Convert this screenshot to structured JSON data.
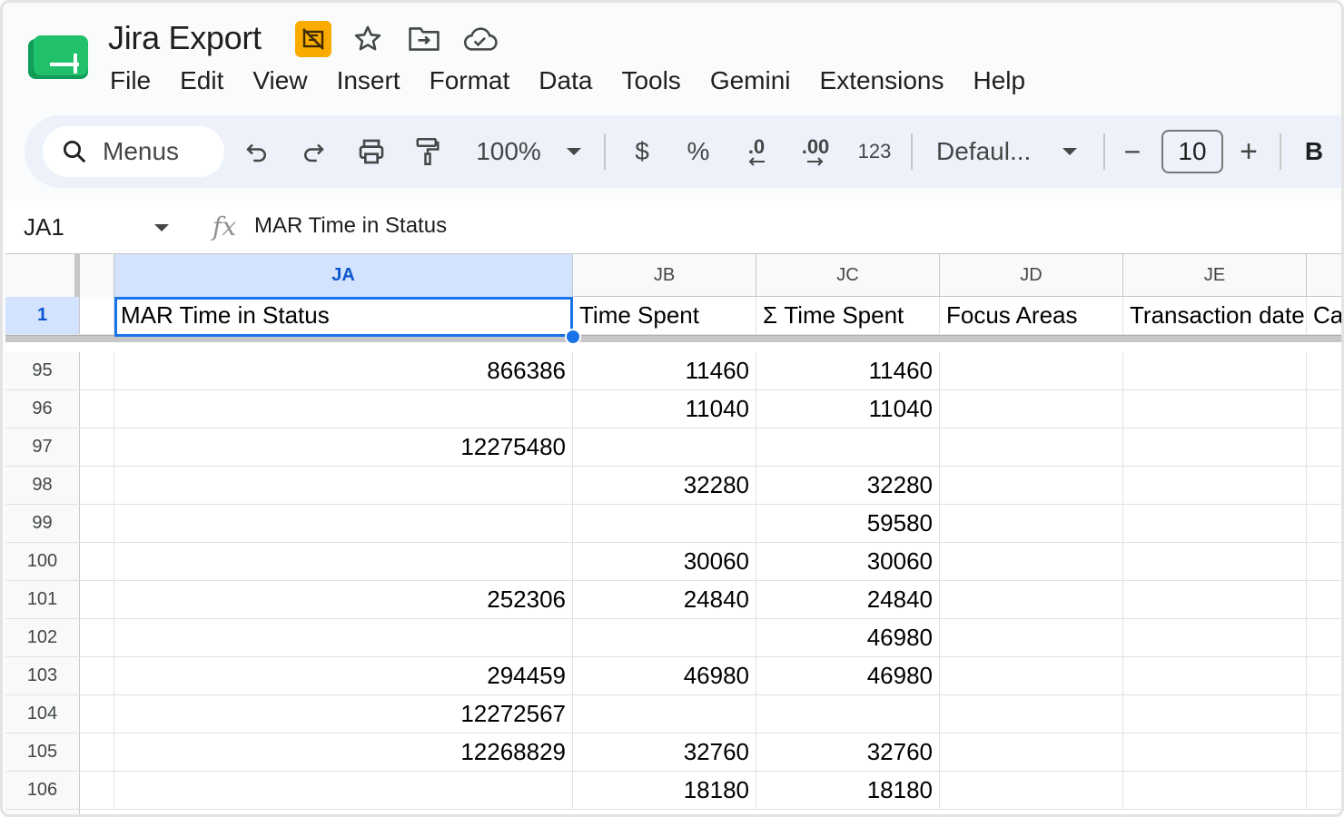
{
  "app": {
    "doc_title": "Jira Export",
    "accent_color": "#1a73e8",
    "logo_color": "#0f9d58"
  },
  "title_icons": [
    "policy-badge-icon",
    "star-icon",
    "move-to-folder-icon",
    "cloud-status-icon"
  ],
  "menu": [
    "File",
    "Edit",
    "View",
    "Insert",
    "Format",
    "Data",
    "Tools",
    "Gemini",
    "Extensions",
    "Help"
  ],
  "toolbar": {
    "search_label": "Menus",
    "zoom": "100%",
    "currency": "$",
    "percent": "%",
    "decrease_decimals": ".0",
    "increase_decimals": ".00",
    "number_format": "123",
    "font": "Defaul...",
    "font_size": "10",
    "bold": "B",
    "minus": "−",
    "plus": "+"
  },
  "formula_bar": {
    "cell_ref": "JA1",
    "fx": "fx",
    "content": "MAR Time in Status"
  },
  "columns": [
    "JA",
    "JB",
    "JC",
    "JD",
    "JE"
  ],
  "header_row": {
    "row_num": "1",
    "cells": [
      "MAR Time in Status",
      "Time Spent",
      "Σ Time Spent",
      "Focus Areas",
      "Transaction date",
      "Ca"
    ]
  },
  "rows": [
    {
      "num": "95",
      "ja": "866386",
      "jb": "11460",
      "jc": "11460"
    },
    {
      "num": "96",
      "ja": "",
      "jb": "11040",
      "jc": "11040"
    },
    {
      "num": "97",
      "ja": "12275480",
      "jb": "",
      "jc": ""
    },
    {
      "num": "98",
      "ja": "",
      "jb": "32280",
      "jc": "32280"
    },
    {
      "num": "99",
      "ja": "",
      "jb": "",
      "jc": "59580"
    },
    {
      "num": "100",
      "ja": "",
      "jb": "30060",
      "jc": "30060"
    },
    {
      "num": "101",
      "ja": "252306",
      "jb": "24840",
      "jc": "24840"
    },
    {
      "num": "102",
      "ja": "",
      "jb": "",
      "jc": "46980"
    },
    {
      "num": "103",
      "ja": "294459",
      "jb": "46980",
      "jc": "46980"
    },
    {
      "num": "104",
      "ja": "12272567",
      "jb": "",
      "jc": ""
    },
    {
      "num": "105",
      "ja": "12268829",
      "jb": "32760",
      "jc": "32760"
    },
    {
      "num": "106",
      "ja": "",
      "jb": "18180",
      "jc": "18180"
    }
  ]
}
